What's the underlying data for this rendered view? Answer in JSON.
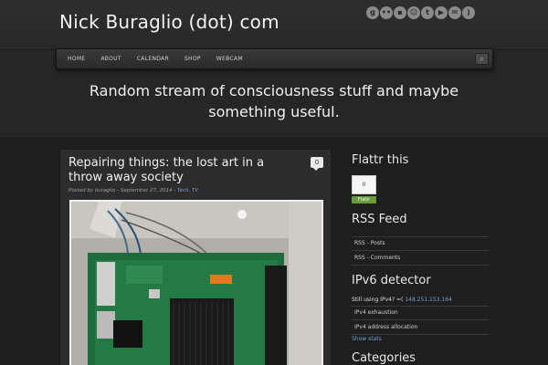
{
  "site": {
    "title": "Nick Buraglio (dot) com",
    "tagline": "Random stream of consciousness stuff and maybe something useful."
  },
  "social_icons": [
    "google-plus-icon",
    "flickr-icon",
    "delicious-icon",
    "reddit-icon",
    "twitter-icon",
    "youtube-icon",
    "email-icon",
    "rss-icon"
  ],
  "nav": {
    "items": [
      "HOME",
      "ABOUT",
      "CALENDAR",
      "SHOP",
      "WEBCAM"
    ]
  },
  "post": {
    "title": "Repairing things: the lost art in a throw away society",
    "meta_prefix": "Posted by buraglio - September 27, 2014 - ",
    "meta_categories": "Tech, TV",
    "comment_count": "0"
  },
  "sidebar": {
    "flattr": {
      "title": "Flattr this",
      "count": "0",
      "button": "Flattr"
    },
    "rss": {
      "title": "RSS Feed",
      "links": [
        "RSS - Posts",
        "RSS - Comments"
      ]
    },
    "ipv6": {
      "title": "IPv6 detector",
      "status_prefix": "Still using IPv4? =( ",
      "ip": "148.251.153.164",
      "links": [
        "IPv4 exhaustion",
        "IPv4 address allocation"
      ],
      "show_stats": "Show stats"
    },
    "categories": {
      "title": "Categories"
    }
  },
  "colors": {
    "background": "#262626",
    "link": "#6fa0d8",
    "flattr_green": "#6a9a3a"
  }
}
